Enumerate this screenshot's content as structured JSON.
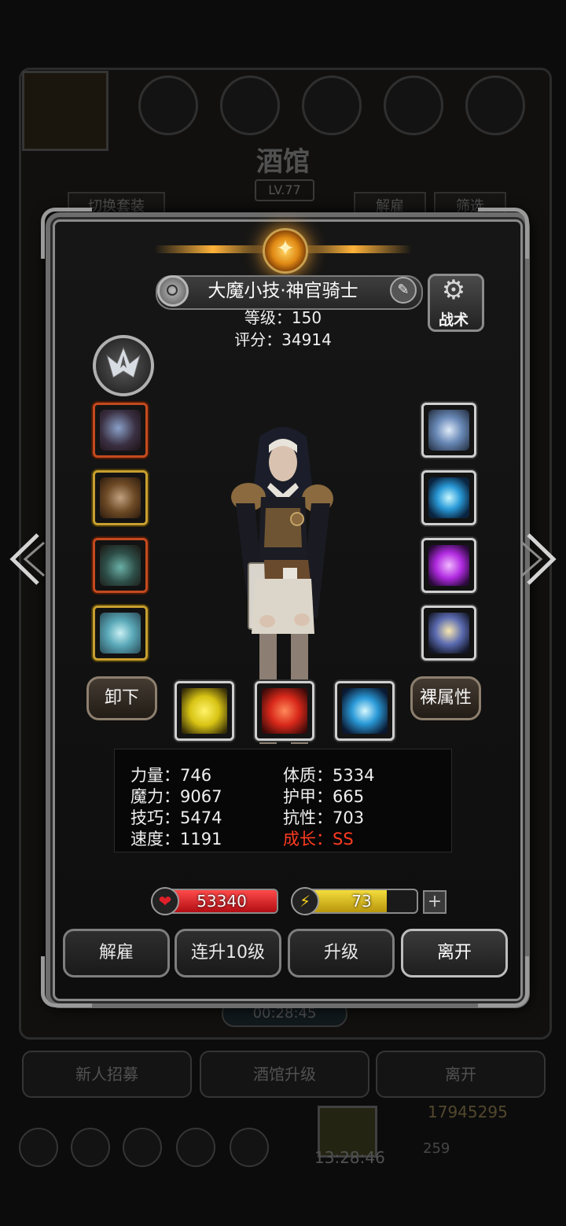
{
  "background": {
    "title": "酒馆",
    "level": "LV.77",
    "tabs": {
      "switch_outfit": "切换套装",
      "dismiss": "解雇",
      "filter": "筛选"
    },
    "timer": "00:28:45",
    "buttons": {
      "recruit": "新人招募",
      "upgrade_tavern": "酒馆升级",
      "leave": "离开"
    },
    "gold": "17945295",
    "gems": "259",
    "clock": "13:28:46"
  },
  "hero": {
    "name": "大魔小技·神官骑士",
    "level": "等级：150",
    "score": "评分：34914",
    "tactics_label": "战术"
  },
  "actions": {
    "unequip": "卸下",
    "base_attributes": "裸属性"
  },
  "stats": {
    "strength": "力量：746",
    "magic": "魔力：9067",
    "skill": "技巧：5474",
    "speed": "速度：1191",
    "constitution": "体质：5334",
    "armor": "护甲：665",
    "resistance": "抗性：703",
    "growth": "成长：SS"
  },
  "bars": {
    "hp": "53340",
    "hp_fill": 1.0,
    "energy": "73",
    "energy_fill": 0.73
  },
  "buttons": {
    "dismiss": "解雇",
    "level_up_10": "连升10级",
    "level_up": "升级",
    "leave": "离开"
  },
  "colors": {
    "hp": "#d81a20",
    "energy": "#e6c21c",
    "growth": "#ff3a20",
    "emblem": "#f0a030"
  },
  "icons": {
    "class_badge": "crest-icon",
    "left_slots": [
      "axe-icon",
      "horned-helmet-icon",
      "amulet-icon",
      "gem-ring-icon"
    ],
    "right_slots": [
      "crown-ring-icon",
      "blue-orb-icon",
      "purple-crystal-icon",
      "lantern-icon"
    ],
    "skills": [
      "fist-icon",
      "red-cross-icon",
      "eye-icon"
    ]
  }
}
